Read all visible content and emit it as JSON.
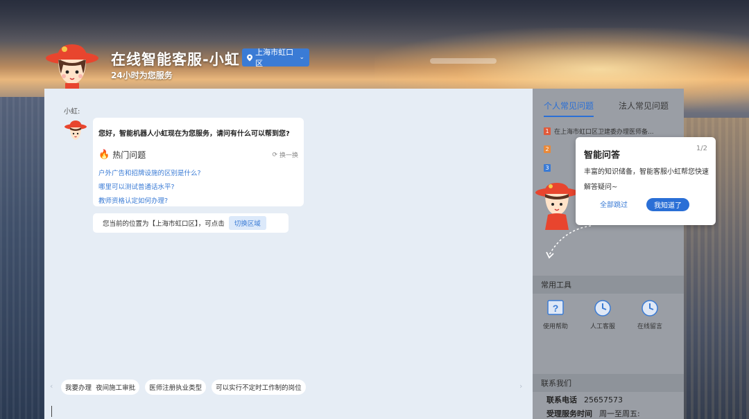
{
  "header": {
    "title": "在线智能客服-小虹",
    "subtitle": "24小时为您服务",
    "location_label": "上海市虹口区"
  },
  "chat": {
    "bot_name": "小虹:",
    "greeting": "您好，智能机器人小虹现在为您服务，请问有什么可以帮到您?",
    "hot_title": "热门问题",
    "refresh_label": "换一换",
    "questions": [
      "户外广告和招牌设施的区别是什么?",
      "哪里可以测试普通话水平?",
      "教师资格认定如何办理?"
    ],
    "location_note": "您当前的位置为【上海市虹口区】，可点击",
    "switch_region": "切换区域",
    "quick_chips": [
      "我要办理",
      "夜间施工审批",
      "医师注册执业类型",
      "可以实行不定时工作制的岗位"
    ]
  },
  "sidebar": {
    "tabs": [
      "个人常见问题",
      "法人常见问题"
    ],
    "faq": [
      {
        "num": "1",
        "text": "在上海市虹口区卫建委办理医师备...",
        "color": "#e05a3a"
      },
      {
        "num": "2",
        "text": "",
        "color": "#e8893a"
      },
      {
        "num": "3",
        "text": "",
        "color": "#3a7bd5"
      }
    ],
    "tools_title": "常用工具",
    "tools": [
      {
        "label": "使用帮助",
        "icon": "help-icon"
      },
      {
        "label": "人工客服",
        "icon": "clock-icon"
      },
      {
        "label": "在线留言",
        "icon": "clock-icon"
      }
    ],
    "contact_title": "联系我们",
    "contact": {
      "phone_label": "联系电话",
      "phone": "25657573",
      "hours_label": "受理服务时间",
      "hours": "周一至周五:"
    }
  },
  "popup": {
    "title": "智能问答",
    "step": "1/2",
    "body": "丰富的知识储备，智能客服小虹帮您快速解答疑问~",
    "skip": "全部跳过",
    "confirm": "我知道了"
  },
  "colors": {
    "accent": "#2a6fd6",
    "link": "#3a7bd5",
    "fire": "#f05a28"
  }
}
